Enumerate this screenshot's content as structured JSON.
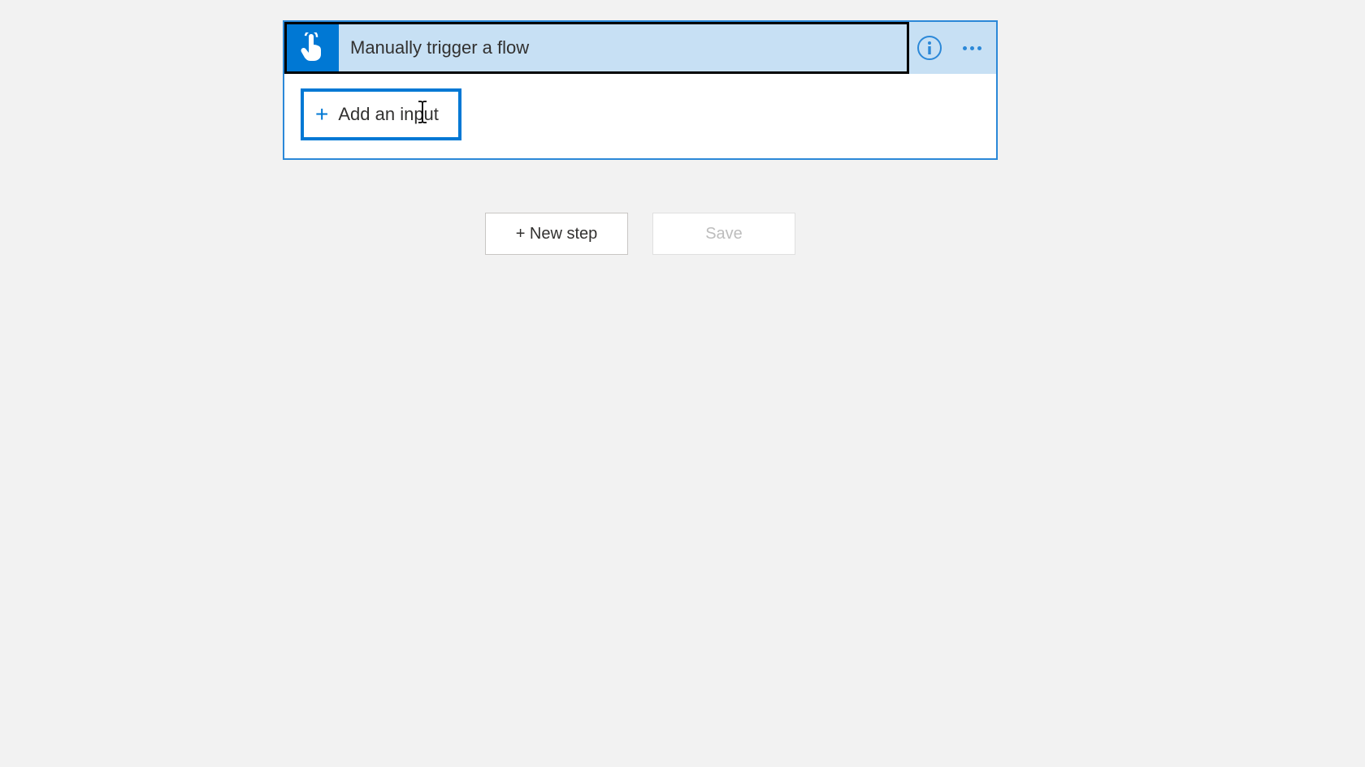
{
  "trigger": {
    "title": "Manually trigger a flow",
    "add_input_label": "Add an input"
  },
  "actions": {
    "new_step": "+ New step",
    "save": "Save"
  }
}
